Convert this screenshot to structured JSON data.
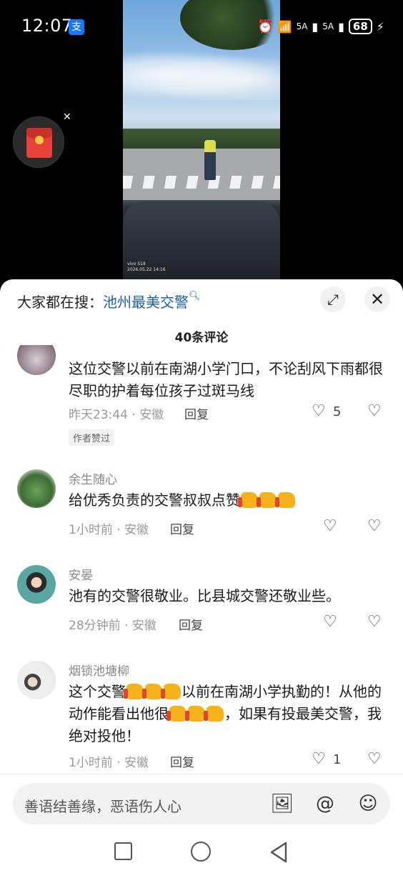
{
  "status_bar": {
    "time": "12:07",
    "app_icon": "支",
    "signal_label_1": "5A",
    "signal_label_2": "5A",
    "battery": "68"
  },
  "video": {
    "watermark_line1": "vivo S18",
    "watermark_line2": "2026.05.22 14:16"
  },
  "sheet": {
    "search_prefix": "大家都在搜：",
    "search_keyword": "池州最美交警",
    "comment_count": "40条评论"
  },
  "comments": [
    {
      "user": "",
      "text": "这位交警以前在南湖小学门口，不论刮风下雨都很尽职的护着每位孩子过斑马线",
      "meta": "昨天23:44 · 安徽",
      "reply": "回复",
      "likes": "5",
      "badge": "作者赞过"
    },
    {
      "user": "余生随心",
      "text": "给优秀负责的交警叔叔点赞",
      "meta": "1小时前 · 安徽",
      "reply": "回复",
      "likes": ""
    },
    {
      "user": "安晏",
      "text": "池有的交警很敬业。比县城交警还敬业些。",
      "meta": "28分钟前 · 安徽",
      "reply": "回复",
      "likes": ""
    },
    {
      "user": "烟锁池塘柳",
      "text_a": "这个交警",
      "text_b": "以前在南湖小学执勤的！从他的动作能看出他很",
      "text_c": "，如果有投最美交警，我绝对投他！",
      "meta": "1小时前 · 安徽",
      "reply": "回复",
      "likes": "1"
    }
  ],
  "input": {
    "placeholder": "善语结善缘，恶语伤人心"
  },
  "icons": {
    "image": "image-icon",
    "at": "at-icon",
    "emoji": "emoji-icon"
  }
}
